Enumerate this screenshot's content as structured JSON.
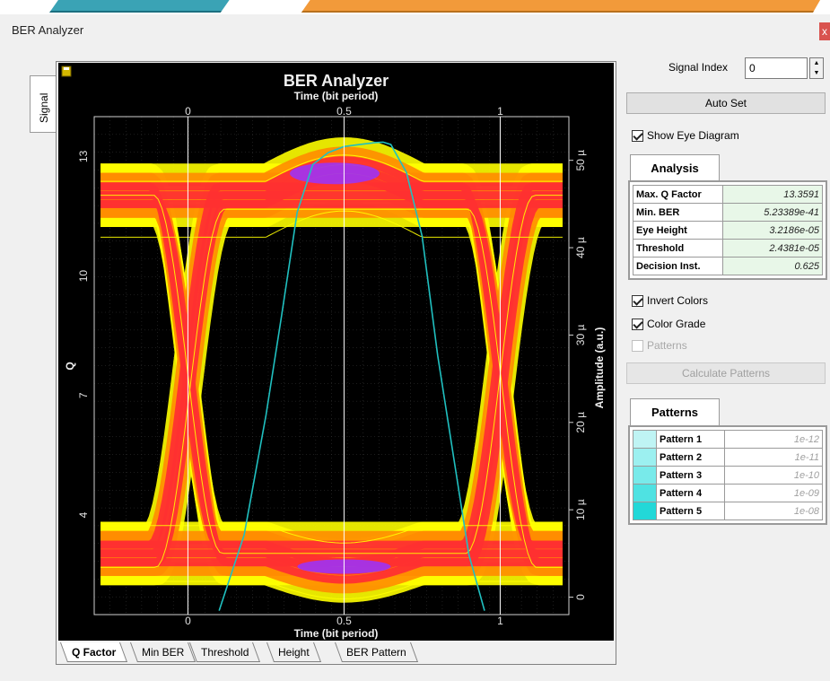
{
  "window": {
    "title": "BER Analyzer",
    "close_label": "x"
  },
  "side_tab": {
    "label": "Signal"
  },
  "chart_data": {
    "type": "line",
    "title": "BER Analyzer",
    "top_axis_label": "Time (bit period)",
    "xlabel": "Time (bit period)",
    "ylabel_left": "Q",
    "ylabel_right": "Amplitude (a.u.)",
    "x_ticks": [
      "0",
      "0.5",
      "1"
    ],
    "left_ticks": [
      "13",
      "10",
      "7",
      "4"
    ],
    "right_ticks": [
      "50 µ",
      "40 µ",
      "30 µ",
      "20 µ",
      "10 µ",
      "0"
    ],
    "xlim": [
      -0.3,
      1.22
    ],
    "ylim_right": [
      -2,
      55
    ],
    "ylim_left": [
      1.5,
      14
    ],
    "legend_icon": "floppy-icon",
    "colors": {
      "background": "#000000",
      "eye_hot": "#ff3030",
      "eye_warm": "#ff8c00",
      "eye_cool": "#ffff00",
      "eye_peak": "#9933ff",
      "q_curve": "#20c0c0",
      "grid": "#3a3a3a"
    },
    "series": [
      {
        "name": "Q Factor",
        "x": [
          0.1,
          0.18,
          0.25,
          0.3,
          0.35,
          0.4,
          0.45,
          0.5,
          0.55,
          0.6,
          0.625,
          0.65,
          0.7,
          0.75,
          0.8,
          0.85,
          0.9,
          0.95
        ],
        "y": [
          1.6,
          3.5,
          6.5,
          9.0,
          11.6,
          12.8,
          13.1,
          13.25,
          13.3,
          13.35,
          13.36,
          13.3,
          12.6,
          11.0,
          8.0,
          5.5,
          3.0,
          1.6
        ]
      }
    ],
    "eye": {
      "level_high": 46,
      "level_low": 5,
      "crossings": [
        0.0,
        1.0
      ],
      "high_spread": 5,
      "low_spread": 5
    }
  },
  "bottom_tabs": [
    "Q Factor",
    "Min BER",
    "Threshold",
    "Height",
    "BER Pattern"
  ],
  "controls": {
    "signal_index_label": "Signal Index",
    "signal_index_value": "0",
    "auto_set_label": "Auto Set",
    "show_eye_label": "Show Eye Diagram",
    "show_eye_checked": true,
    "invert_colors_label": "Invert Colors",
    "invert_colors_checked": true,
    "color_grade_label": "Color Grade",
    "color_grade_checked": true,
    "patterns_label": "Patterns",
    "patterns_checked": false,
    "calculate_patterns_label": "Calculate Patterns"
  },
  "analysis": {
    "title": "Analysis",
    "rows": [
      {
        "key": "Max. Q Factor",
        "value": "13.3591"
      },
      {
        "key": "Min. BER",
        "value": "5.23389e-41"
      },
      {
        "key": "Eye Height",
        "value": "3.2186e-05"
      },
      {
        "key": "Threshold",
        "value": "2.4381e-05"
      },
      {
        "key": "Decision Inst.",
        "value": "0.625"
      }
    ]
  },
  "patterns": {
    "title": "Patterns",
    "rows": [
      {
        "key": "Pattern 1",
        "value": "1e-12",
        "color": "#bff4f4"
      },
      {
        "key": "Pattern 2",
        "value": "1e-11",
        "color": "#9cf0f0"
      },
      {
        "key": "Pattern 3",
        "value": "1e-10",
        "color": "#78eaea"
      },
      {
        "key": "Pattern 4",
        "value": "1e-09",
        "color": "#4fe2e2"
      },
      {
        "key": "Pattern 5",
        "value": "1e-08",
        "color": "#22d8d8"
      }
    ]
  }
}
